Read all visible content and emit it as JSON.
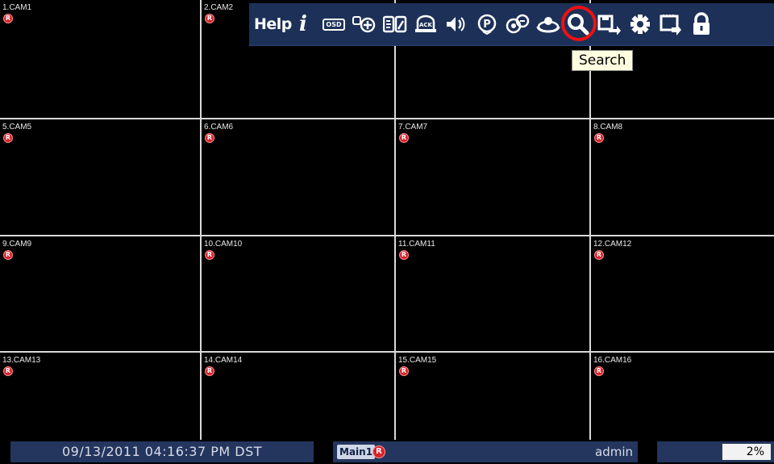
{
  "cameras": [
    {
      "label": "1.CAM1",
      "rec": "R"
    },
    {
      "label": "2.CAM2",
      "rec": "R"
    },
    {
      "label": "",
      "rec": ""
    },
    {
      "label": "",
      "rec": ""
    },
    {
      "label": "5.CAM5",
      "rec": "R"
    },
    {
      "label": "6.CAM6",
      "rec": "R"
    },
    {
      "label": "7.CAM7",
      "rec": "R"
    },
    {
      "label": "8.CAM8",
      "rec": "R"
    },
    {
      "label": "9.CAM9",
      "rec": "R"
    },
    {
      "label": "10.CAM10",
      "rec": "R"
    },
    {
      "label": "11.CAM11",
      "rec": "R"
    },
    {
      "label": "12.CAM12",
      "rec": "R"
    },
    {
      "label": "13.CAM13",
      "rec": "R"
    },
    {
      "label": "14.CAM14",
      "rec": "R"
    },
    {
      "label": "15.CAM15",
      "rec": "R"
    },
    {
      "label": "16.CAM16",
      "rec": "R"
    }
  ],
  "toolbar": {
    "help_label": "Help",
    "info_glyph": "i",
    "osd_label": "OSD",
    "ack_label": "ACK",
    "ptz_glyph": "P",
    "icons": [
      "info-icon",
      "osd-icon",
      "zoom-icon",
      "freeze-icon",
      "alarm-ack-icon",
      "audio-icon",
      "ptz-icon",
      "group-icon",
      "sequence-icon",
      "search-icon",
      "export-icon",
      "setup-icon",
      "clip-copy-icon",
      "lock-icon"
    ],
    "tooltip": "Search"
  },
  "status": {
    "datetime": "09/13/2011 04:16:37 PM DST",
    "main_label": "Main1",
    "main_rec": "R",
    "user": "admin",
    "usage": "2%"
  },
  "colors": {
    "toolbar_bg": "#1c3058",
    "status_bg": "#24355e",
    "record_red": "#d6232a",
    "highlight_red": "#ee1111",
    "grid_line": "#d9d9d9"
  }
}
